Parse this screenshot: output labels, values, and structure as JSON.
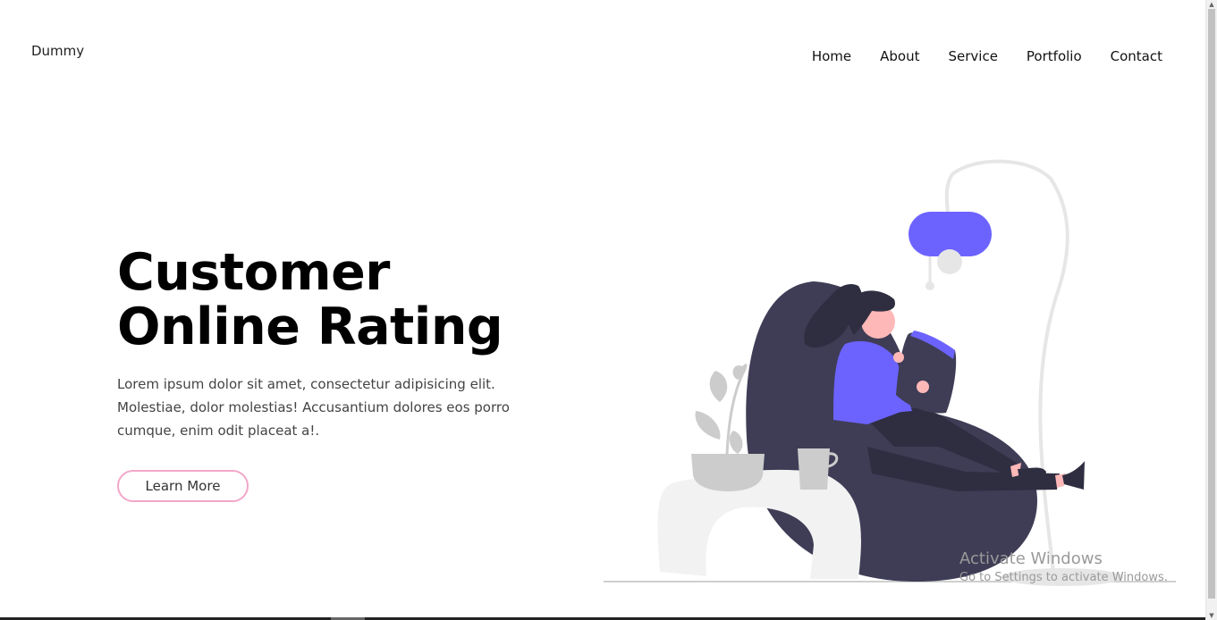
{
  "header": {
    "logo_alt": "Dummy",
    "nav": [
      {
        "label": "Home"
      },
      {
        "label": "About"
      },
      {
        "label": "Service"
      },
      {
        "label": "Portfolio"
      },
      {
        "label": "Contact"
      }
    ]
  },
  "hero": {
    "title_line1": "Customer",
    "title_line2": "Online Rating",
    "description": "Lorem ipsum dolor sit amet, consectetur adipisicing elit. Molestiae, dolor molestias! Accusantium dolores eos porro cumque, enim odit placeat a!.",
    "cta_label": "Learn More"
  },
  "illustration": {
    "subject": "woman-reading-tablet-in-bean-bag",
    "accent_color": "#6c63ff",
    "dark_color": "#3f3d56"
  },
  "watermark": {
    "title": "Activate Windows",
    "subtitle": "Go to Settings to activate Windows."
  },
  "colors": {
    "cta_border": "#f2a7c8",
    "text_dark": "#000000",
    "text_body": "#444444"
  }
}
